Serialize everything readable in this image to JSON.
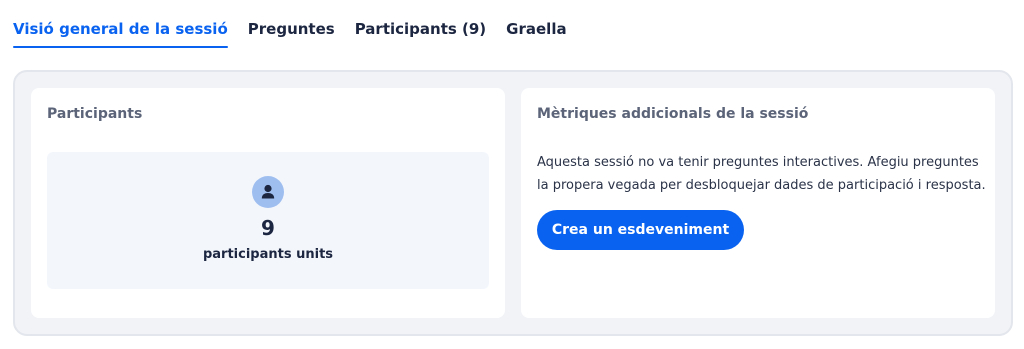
{
  "tabs": [
    {
      "label": "Visió general de la sessió",
      "active": true
    },
    {
      "label": "Preguntes",
      "active": false
    },
    {
      "label": "Participants (9)",
      "active": false
    },
    {
      "label": "Graella",
      "active": false
    }
  ],
  "participants_card": {
    "title": "Participants",
    "icon": "user-icon",
    "value": "9",
    "label": "participants units"
  },
  "metrics_card": {
    "title": "Mètriques addicionals de la sessió",
    "description": "Aquesta sessió no va tenir preguntes interactives. Afegiu preguntes la propera vegada per desbloquejar dades de participació i resposta.",
    "cta_label": "Crea un esdeveniment"
  },
  "colors": {
    "accent": "#0a63f0",
    "text": "#1c2640",
    "panel": "#f1f3f7"
  }
}
